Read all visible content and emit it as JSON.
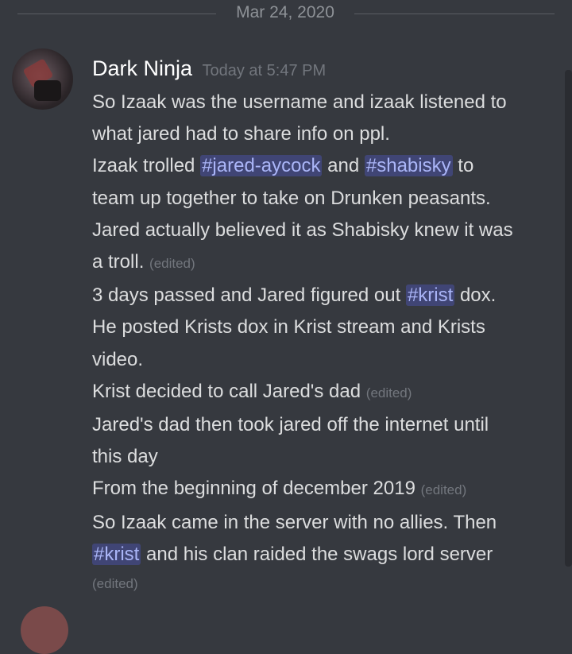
{
  "date_divider": "Mar 24, 2020",
  "author": {
    "name": "Dark Ninja",
    "timestamp": "Today at 5:47 PM"
  },
  "mentions": {
    "jared_aycock": "#jared-aycock",
    "shabisky": "#shabisky",
    "krist": "#krist"
  },
  "edited_label": "(edited)",
  "lines": {
    "l1": "So Izaak was the username and izaak listened to",
    "l2": "what jared had to share info on ppl.",
    "l3_a": "Izaak trolled",
    "l3_b": "and",
    "l3_c": "to",
    "l4": "team up together to take on Drunken peasants.",
    "l5": "Jared actually believed it as Shabisky knew it was",
    "l6": "a troll.",
    "l7_a": "3 days passed and Jared figured out",
    "l7_b": "dox.",
    "l8": "He posted Krists dox in Krist stream and Krists",
    "l9": "video.",
    "l10": "Krist decided to call Jared's dad",
    "l11": "Jared's dad then took jared off the internet until",
    "l12": "this day",
    "l13": "From the beginning of december 2019",
    "l14": "So Izaak came in the server with no allies. Then",
    "l15_b": "and his clan raided the swags lord server"
  }
}
